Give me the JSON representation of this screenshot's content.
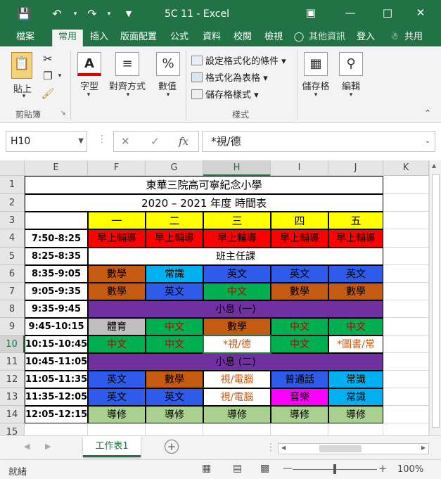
{
  "window": {
    "title": "5C 11 - Excel",
    "buttons": [
      "undo",
      "redo",
      "customize"
    ],
    "controls": [
      "ribbon-display",
      "minimize",
      "maximize",
      "close"
    ]
  },
  "tabs": [
    "檔案",
    "常用",
    "插入",
    "版面配置",
    "公式",
    "資料",
    "校閱",
    "檢視",
    "其他資訊",
    "登入",
    "共用"
  ],
  "ribbon": {
    "clipboard": {
      "paste": "貼上",
      "group": "剪貼簿"
    },
    "font": "字型",
    "alignment": "對齊方式",
    "number": "數值",
    "styles": {
      "conditional": "設定格式化的條件",
      "table": "格式化為表格",
      "cell_styles": "儲存格樣式",
      "group": "樣式"
    },
    "cells": "儲存格",
    "editing": "編輯"
  },
  "formula_bar": {
    "name_box": "H10",
    "value": "*視/德",
    "fx": "fx"
  },
  "columns": [
    "E",
    "F",
    "G",
    "H",
    "I",
    "J",
    "K"
  ],
  "rows": [
    "1",
    "2",
    "3",
    "4",
    "5",
    "6",
    "7",
    "8",
    "9",
    "10",
    "11",
    "12",
    "13",
    "14",
    "15"
  ],
  "sheet": {
    "title": "東華三院高可寧紀念小學",
    "subtitle": "2020 – 2021 年度  時間表",
    "days": [
      "一",
      "二",
      "三",
      "四",
      "五"
    ],
    "times": [
      "7:50-8:25",
      "8:25-8:35",
      "8:35-9:05",
      "9:05-9:35",
      "9:35-9:45",
      "9:45-10:15",
      "10:15-10:45",
      "10:45-11:05",
      "11:05-11:35",
      "11:35-12:05",
      "12:05-12:15"
    ],
    "morning": "早上輔導",
    "homeroom": "班主任課",
    "recess1": "小息 (一)",
    "recess2": "小息 (二)",
    "row6": [
      "數學",
      "常識",
      "英文",
      "英文",
      "英文"
    ],
    "row7": [
      "數學",
      "英文",
      "中文",
      "數學",
      "數學"
    ],
    "row9": [
      "體育",
      "中文",
      "數學",
      "中文",
      "中文"
    ],
    "row10": [
      "中文",
      "中文",
      "*視/德",
      "中文",
      "*圖書/常"
    ],
    "row12": [
      "英文",
      "數學",
      "視/電腦",
      "普通話",
      "常識"
    ],
    "row13": [
      "英文",
      "英文",
      "視/電腦",
      "音樂",
      "常識"
    ],
    "row14": [
      "導修",
      "導修",
      "導修",
      "導修",
      "導修"
    ]
  },
  "colors": {
    "excel_green": "#217346",
    "yellow": "#ffff00",
    "red": "#ff0000",
    "orange": "#c55a11",
    "blue": "#2f5bea",
    "cyan": "#00b0f0",
    "green": "#00b050",
    "purple": "#7030a0",
    "gray": "#bfbfbf",
    "light_green": "#a9d08e",
    "magenta": "#ff00ff"
  },
  "sheet_tab": "工作表1",
  "status": {
    "ready": "就緒",
    "zoom": "100%"
  }
}
